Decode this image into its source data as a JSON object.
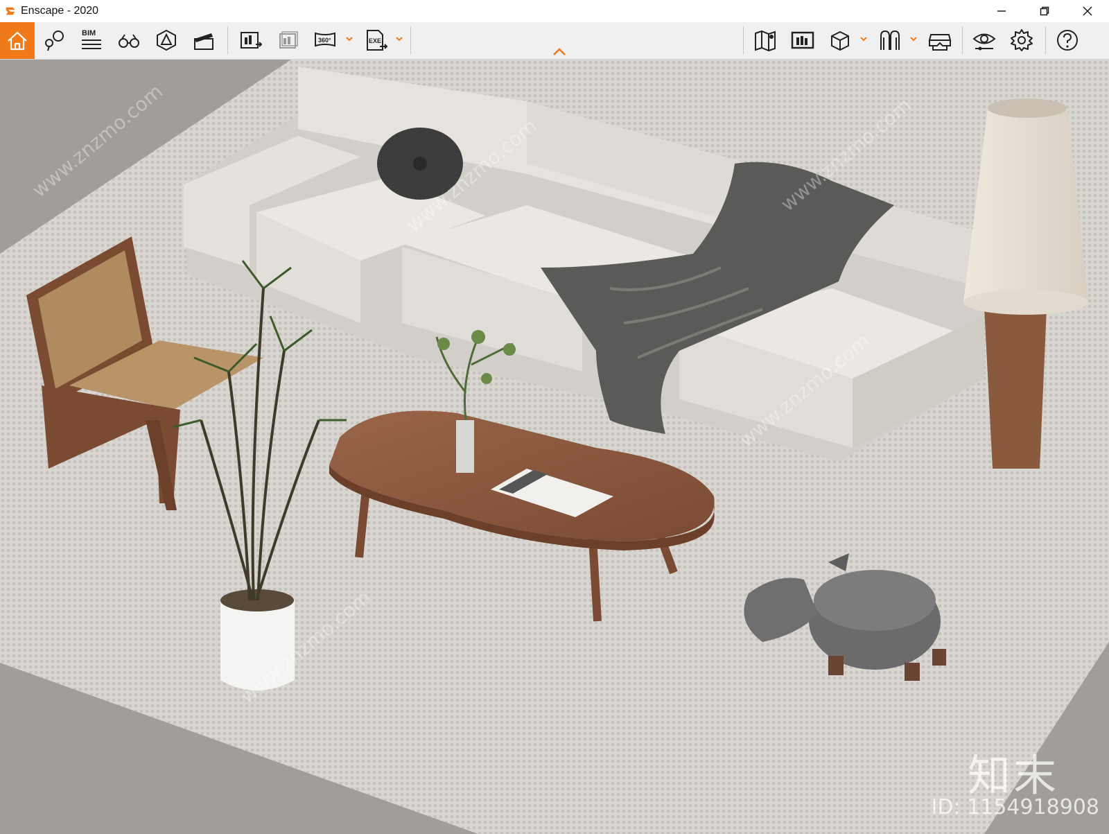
{
  "window": {
    "title": "Enscape - 2020",
    "minimize_icon": "minimize-icon",
    "restore_icon": "restore-icon",
    "close_icon": "close-icon"
  },
  "toolbar": {
    "bim_label": "BIM",
    "panorama_label": "360°",
    "exe_label": "EXE",
    "left_group": [
      "home-icon",
      "views-icon",
      "bim-info-icon",
      "binoculars-icon",
      "site-context-icon",
      "video-editor-icon"
    ],
    "middle_group": [
      "render-screenshot-icon",
      "batch-render-icon",
      "panorama-icon",
      "exe-export-icon"
    ],
    "right_group": [
      "map-icon",
      "visual-settings-icon",
      "asset-library-icon",
      "material-editor-icon",
      "vr-headset-icon",
      "view-options-icon",
      "settings-gear-icon",
      "help-icon"
    ],
    "accent_color": "#f07a1a"
  },
  "viewport": {
    "watermark_logo": "知末",
    "watermark_id": "ID: 1154918908",
    "tiled_watermark": "www.znzmo.com"
  }
}
